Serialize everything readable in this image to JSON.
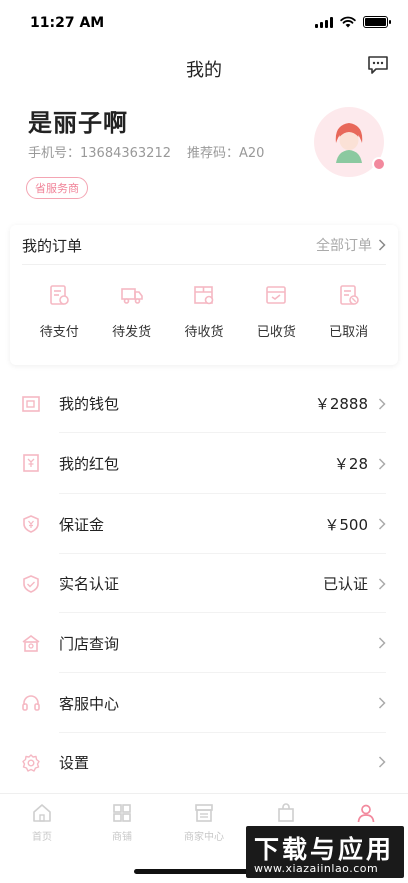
{
  "status_bar": {
    "time": "11:27 AM"
  },
  "nav": {
    "title": "我的",
    "message_icon": "chat-bubble-icon"
  },
  "profile": {
    "name": "是丽子啊",
    "phone": "手机号：13684363212",
    "referral": "推荐码：A20",
    "badge": "省服务商"
  },
  "orders": {
    "title": "我的订单",
    "all_label": "全部订单",
    "items": [
      {
        "label": "待支付",
        "icon": "pending-payment-icon"
      },
      {
        "label": "待发货",
        "icon": "truck-icon"
      },
      {
        "label": "待收货",
        "icon": "package-icon"
      },
      {
        "label": "已收货",
        "icon": "received-icon"
      },
      {
        "label": "已取消",
        "icon": "cancelled-icon"
      }
    ]
  },
  "menu": [
    {
      "label": "我的钱包",
      "value": "￥2888",
      "icon": "wallet-icon"
    },
    {
      "label": "我的红包",
      "value": "￥28",
      "icon": "red-packet-icon"
    },
    {
      "label": "保证金",
      "value": "￥500",
      "icon": "deposit-shield-icon"
    },
    {
      "label": "实名认证",
      "value": "已认证",
      "icon": "verified-shield-icon"
    },
    {
      "label": "门店查询",
      "value": "",
      "icon": "store-icon"
    },
    {
      "label": "客服中心",
      "value": "",
      "icon": "headset-icon"
    },
    {
      "label": "设置",
      "value": "",
      "icon": "gear-icon"
    }
  ],
  "tabs": [
    {
      "label": "首页",
      "icon": "home-icon"
    },
    {
      "label": "商铺",
      "icon": "grid-icon"
    },
    {
      "label": "商家中心",
      "icon": "shop-icon"
    },
    {
      "label": "",
      "icon": "bag-icon"
    },
    {
      "label": "",
      "icon": "user-icon"
    }
  ],
  "watermark": {
    "title": "下载与应用",
    "url": "www.xiazaiinlao.com"
  },
  "colors": {
    "accent": "#f2899d",
    "icon_pink": "#f5b8c3",
    "text_muted": "#999999"
  }
}
